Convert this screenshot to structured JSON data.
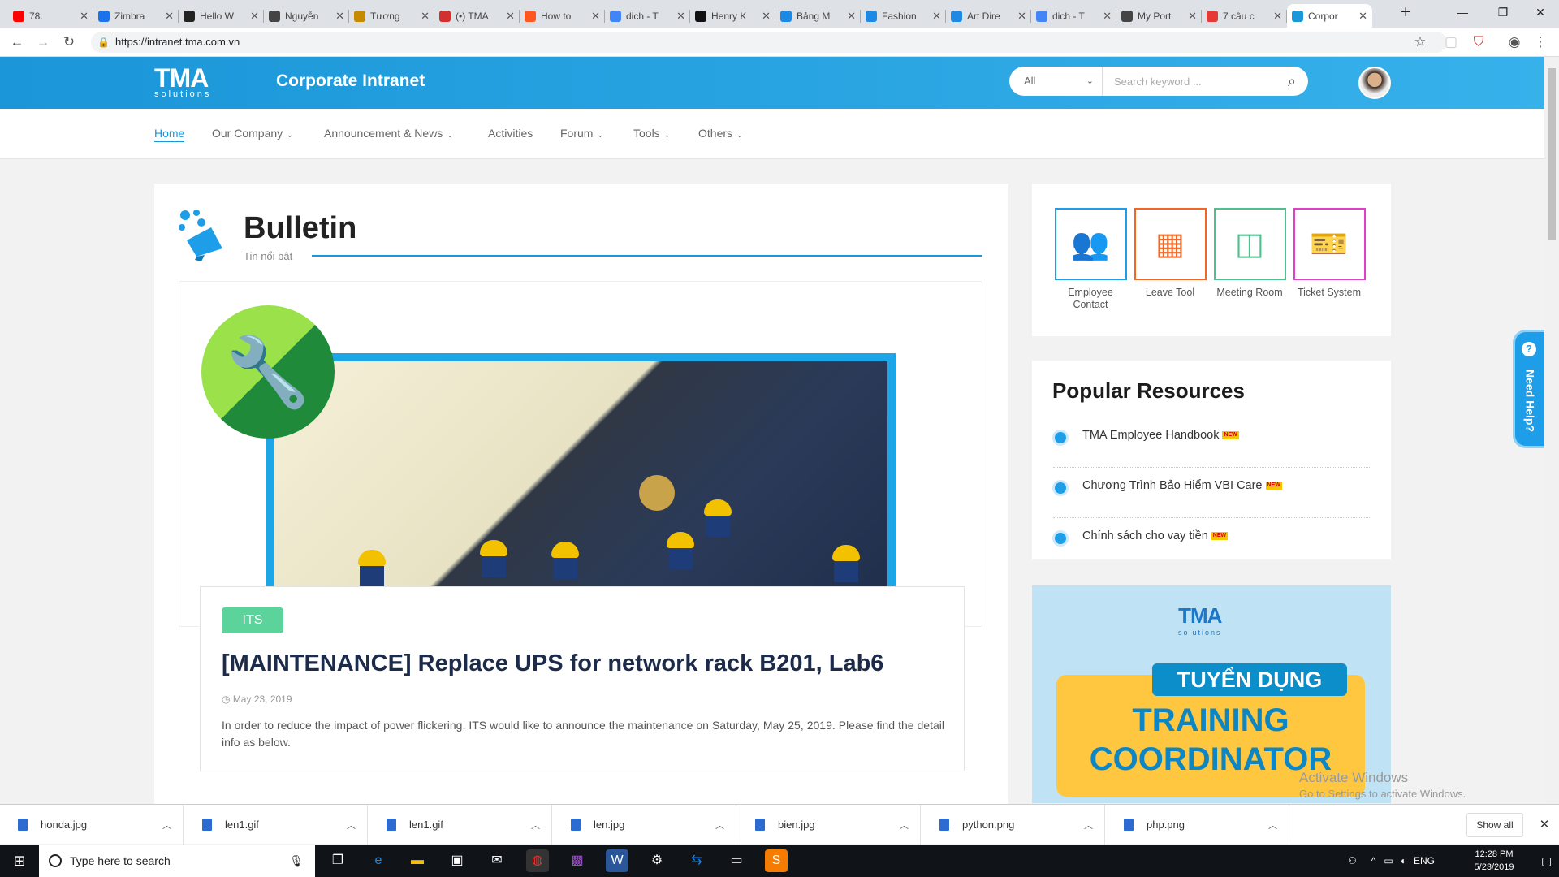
{
  "browser": {
    "tabs": [
      {
        "label": "78.",
        "icon_color": "#ff0000",
        "icon_name": "youtube-icon"
      },
      {
        "label": "Zimbra",
        "icon_color": "#1a73e8",
        "icon_name": "zimbra-icon"
      },
      {
        "label": "Hello W",
        "icon_color": "#222222",
        "icon_name": "hello-icon"
      },
      {
        "label": "Nguyễn",
        "icon_color": "#444444",
        "icon_name": "github-icon"
      },
      {
        "label": "Tương",
        "icon_color": "#c58b00",
        "icon_name": "balloon-icon"
      },
      {
        "label": "(•) TMA",
        "icon_color": "#d32f2f",
        "icon_name": "chat-icon"
      },
      {
        "label": "How to",
        "icon_color": "#ff5722",
        "icon_name": "hubspot-icon"
      },
      {
        "label": "dich - T",
        "icon_color": "#4285f4",
        "icon_name": "google-icon"
      },
      {
        "label": "Henry K",
        "icon_color": "#111111",
        "icon_name": "grid-icon"
      },
      {
        "label": "Bảng M",
        "icon_color": "#1e88e5",
        "icon_name": "doc-icon"
      },
      {
        "label": "Fashion",
        "icon_color": "#1e88e5",
        "icon_name": "x-icon"
      },
      {
        "label": "Art Dire",
        "icon_color": "#1e88e5",
        "icon_name": "x-icon"
      },
      {
        "label": "dich - T",
        "icon_color": "#4285f4",
        "icon_name": "google-icon"
      },
      {
        "label": "My Port",
        "icon_color": "#444444",
        "icon_name": "github-icon"
      },
      {
        "label": "7 câu c",
        "icon_color": "#e53935",
        "icon_name": "flipboard-icon"
      },
      {
        "label": "Corpor",
        "icon_color": "#1a96d9",
        "icon_name": "tma-icon",
        "active": true
      }
    ],
    "url": "https://intranet.tma.com.vn"
  },
  "header": {
    "logo_main": "TMA",
    "logo_sub": "solutions",
    "site_title": "Corporate Intranet",
    "search_scope": "All",
    "search_placeholder": "Search keyword ..."
  },
  "nav": {
    "items": [
      {
        "label": "Home",
        "active": true,
        "dropdown": false
      },
      {
        "label": "Our Company",
        "dropdown": true
      },
      {
        "label": "Announcement & News",
        "dropdown": true
      },
      {
        "label": "Activities",
        "dropdown": false
      },
      {
        "label": "Forum",
        "dropdown": true
      },
      {
        "label": "Tools",
        "dropdown": true
      },
      {
        "label": "Others",
        "dropdown": true
      }
    ]
  },
  "bulletin": {
    "title": "Bulletin",
    "subtitle": "Tin nổi bật",
    "post": {
      "tag": "ITS",
      "title": "[MAINTENANCE] Replace UPS for network rack B201, Lab6",
      "date": "May 23, 2019",
      "excerpt": "In order to reduce the impact of power flickering, ITS would like to announce the maintenance on Saturday, May 25, 2019. Please find the detail info as below."
    }
  },
  "quick_links": [
    {
      "label": "Employee Contact",
      "color": "#1e9ee8",
      "icon_name": "people-icon"
    },
    {
      "label": "Leave Tool",
      "color": "#f26522",
      "icon_name": "calendar-icon"
    },
    {
      "label": "Meeting Room",
      "color": "#4fc08d",
      "icon_name": "meeting-icon"
    },
    {
      "label": "Ticket System",
      "color": "#e040c8",
      "icon_name": "ticket-icon"
    }
  ],
  "popular": {
    "title": "Popular Resources",
    "new_badge": "NEW",
    "items": [
      {
        "label": "TMA Employee Handbook"
      },
      {
        "label": "Chương Trình Bảo Hiểm VBI Care"
      },
      {
        "label": "Chính sách cho vay tiền"
      }
    ]
  },
  "recruit_banner": {
    "logo_main": "TMA",
    "logo_sub": "solutions",
    "pill": "TUYỂN DỤNG",
    "line1": "TRAINING",
    "line2": "COORDINATOR"
  },
  "watermark": {
    "line1": "Activate Windows",
    "line2": "Go to Settings to activate Windows."
  },
  "help_tab": {
    "label": "Need Help?"
  },
  "downloads": {
    "files": [
      "honda.jpg",
      "len1.gif",
      "len1.gif",
      "len.jpg",
      "bien.jpg",
      "python.png",
      "php.png"
    ],
    "show_all": "Show all"
  },
  "taskbar": {
    "search_placeholder": "Type here to search",
    "lang": "ENG",
    "time": "12:28 PM",
    "date": "5/23/2019"
  }
}
